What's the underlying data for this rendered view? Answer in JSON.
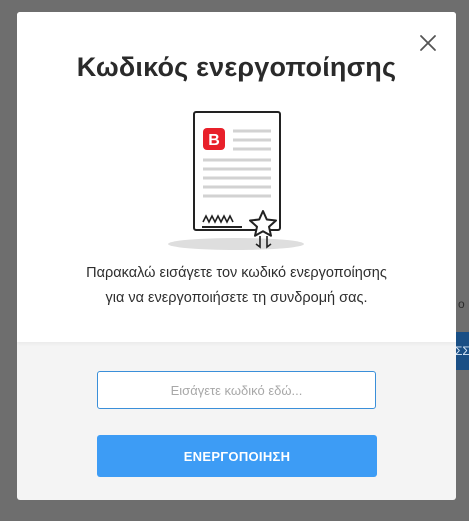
{
  "background": {
    "peek_text": "ο",
    "peek_button_text": "ΣΣ"
  },
  "modal": {
    "close_icon": "close-icon",
    "title": "Κωδικός ενεργοποίησης",
    "illustration_icon": "certificate-icon",
    "brand_letter": "B",
    "description_line1": "Παρακαλώ εισάγετε τον κωδικό ενεργοποίησης",
    "description_line2": "για να ενεργοποιήσετε τη συνδρομή σας.",
    "input_placeholder": "Εισάγετε κωδικό εδώ...",
    "input_value": "",
    "activate_label": "ΕΝΕΡΓΟΠΟΙΗΣΗ"
  },
  "colors": {
    "brand_red": "#e8202a",
    "accent_blue": "#3d9cf5",
    "input_border": "#3a8fd9",
    "overlay": "#6e6e6e"
  }
}
